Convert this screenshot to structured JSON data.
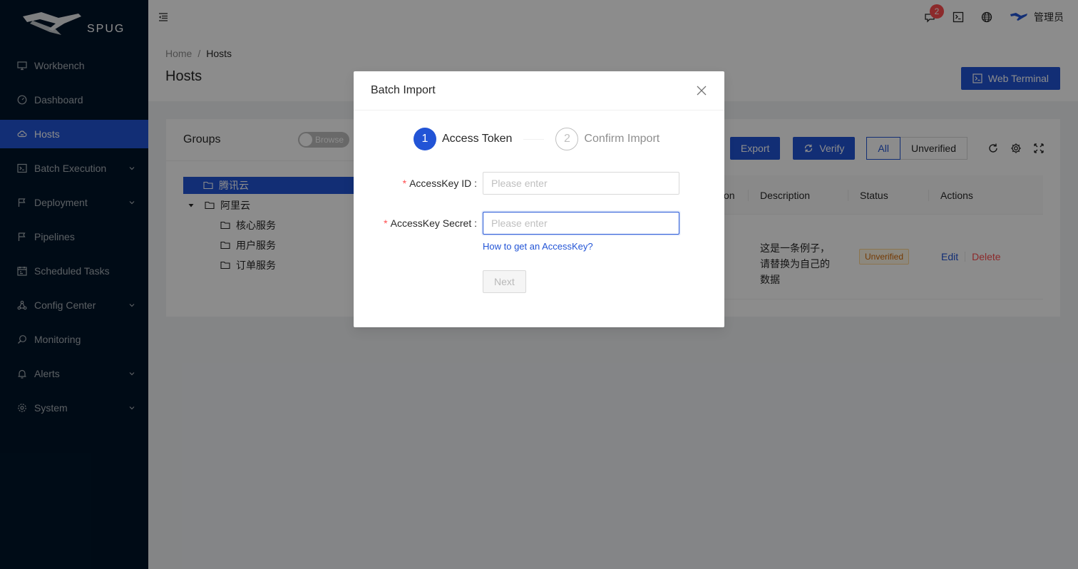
{
  "app": {
    "logo_text": "SPUG"
  },
  "sidebar": {
    "items": [
      {
        "label": "Workbench",
        "icon": "desktop-icon",
        "has_submenu": false
      },
      {
        "label": "Dashboard",
        "icon": "dashboard-icon",
        "has_submenu": false
      },
      {
        "label": "Hosts",
        "icon": "cloud-server-icon",
        "has_submenu": false,
        "active": true
      },
      {
        "label": "Batch Execution",
        "icon": "code-icon",
        "has_submenu": true
      },
      {
        "label": "Deployment",
        "icon": "flag-icon",
        "has_submenu": true
      },
      {
        "label": "Pipelines",
        "icon": "flag-icon",
        "has_submenu": false
      },
      {
        "label": "Scheduled Tasks",
        "icon": "schedule-icon",
        "has_submenu": false
      },
      {
        "label": "Config Center",
        "icon": "deployment-unit-icon",
        "has_submenu": true
      },
      {
        "label": "Monitoring",
        "icon": "monitor-icon",
        "has_submenu": false
      },
      {
        "label": "Alerts",
        "icon": "alert-icon",
        "has_submenu": true
      },
      {
        "label": "System",
        "icon": "setting-icon",
        "has_submenu": true
      }
    ]
  },
  "header": {
    "notification_count": "2",
    "username": "管理员"
  },
  "page": {
    "breadcrumb": [
      "Home",
      "Hosts"
    ],
    "title": "Hosts",
    "web_terminal_label": "Web Terminal"
  },
  "groups": {
    "title": "Groups",
    "switch_label": "Browse",
    "tree": [
      {
        "label": "腾讯云",
        "level": 0,
        "selected": true,
        "expandable": false
      },
      {
        "label": "阿里云",
        "level": 0,
        "selected": false,
        "expandable": true
      },
      {
        "label": "核心服务",
        "level": 1
      },
      {
        "label": "用户服务",
        "level": 1
      },
      {
        "label": "订单服务",
        "level": 1
      }
    ]
  },
  "toolbar": {
    "export_label": "Export",
    "verify_label": "Verify",
    "filter_all": "All",
    "filter_unverified": "Unverified"
  },
  "table": {
    "columns": [
      "on",
      "Description",
      "Status",
      "Actions"
    ],
    "row": {
      "description_lines": [
        "这是一条例子，",
        "请替换为自己的",
        "数据"
      ],
      "status": "Unverified",
      "edit_label": "Edit",
      "delete_label": "Delete"
    }
  },
  "modal": {
    "title": "Batch Import",
    "steps": [
      {
        "number": "1",
        "title": "Access Token",
        "state": "active"
      },
      {
        "number": "2",
        "title": "Confirm Import",
        "state": "wait"
      }
    ],
    "fields": {
      "access_key_id_label": "AccessKey ID",
      "access_key_id_placeholder": "Please enter",
      "access_key_secret_label": "AccessKey Secret",
      "access_key_secret_placeholder": "Please enter"
    },
    "help_link": "How to get an AccessKey?",
    "next_label": "Next"
  },
  "colors": {
    "primary": "#2254d6",
    "sidebar_bg": "#001529",
    "danger": "#ff4d4f",
    "warning_tag": "#d46b08"
  }
}
